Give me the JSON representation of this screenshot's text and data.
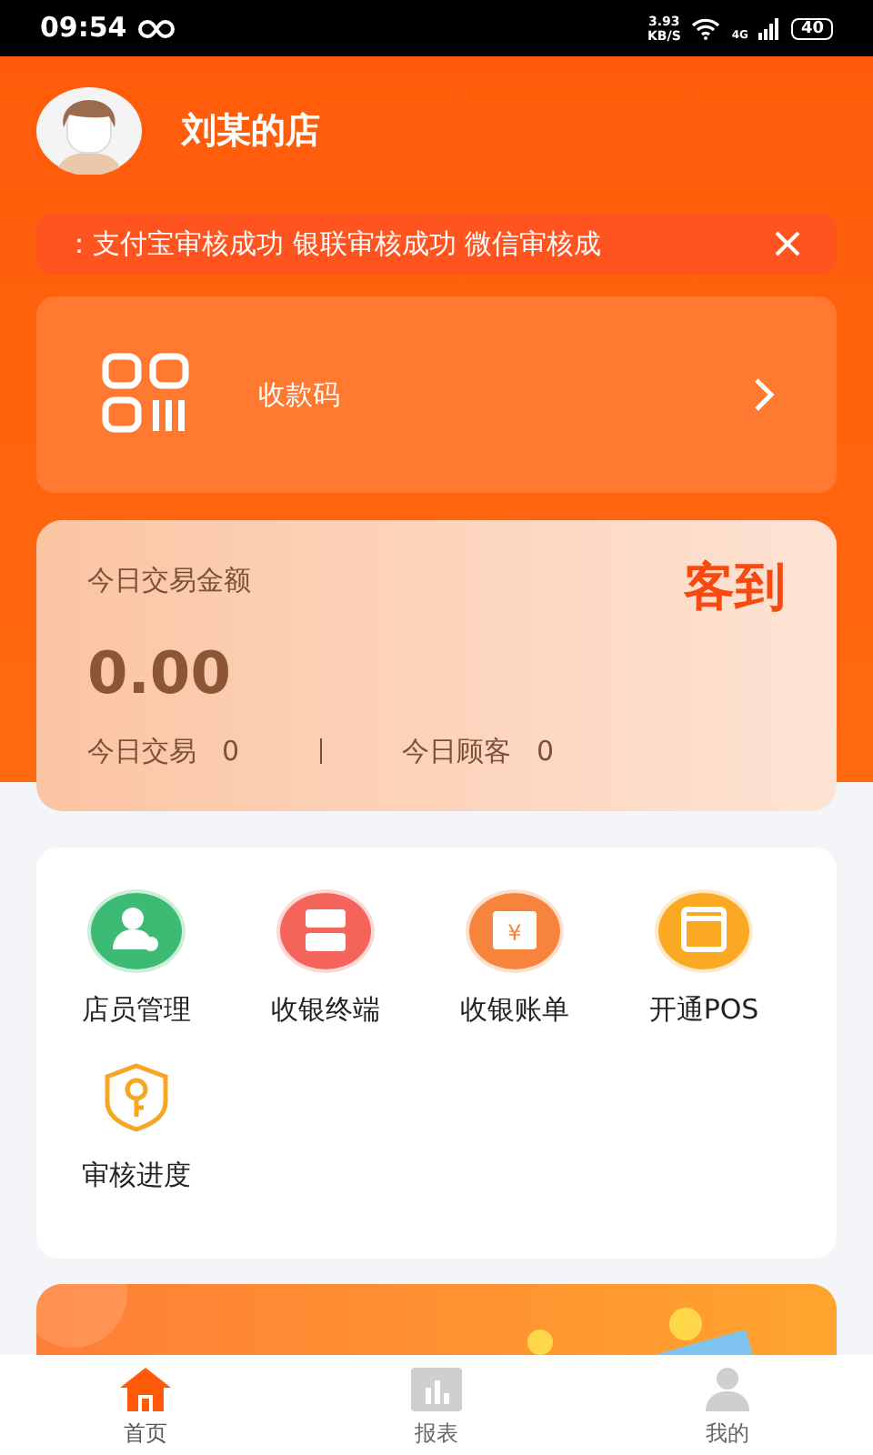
{
  "status_bar": {
    "time": "09:54",
    "speed_value": "3.93",
    "speed_unit": "KB/S",
    "network": "4G",
    "battery": "40"
  },
  "shop": {
    "name": "刘某的店"
  },
  "notice": {
    "text": "：支付宝审核成功 银联审核成功 微信审核成"
  },
  "payment_code": {
    "label": "收款码"
  },
  "stats": {
    "title": "今日交易金额",
    "amount": "0.00",
    "checkin": "客到",
    "items": [
      {
        "label": "今日交易",
        "value": "0"
      },
      {
        "label": "今日顾客",
        "value": "0"
      }
    ]
  },
  "menu": [
    {
      "kind": "staff",
      "label": "店员管理",
      "color": "#3dba74"
    },
    {
      "kind": "terminal",
      "label": "收银终端",
      "color": "#f4645a"
    },
    {
      "kind": "bill",
      "label": "收银账单",
      "color": "#f7843c",
      "symbol": "¥"
    },
    {
      "kind": "pos",
      "label": "开通POS",
      "color": "#fba823"
    },
    {
      "kind": "audit",
      "label": "审核进度",
      "color": "#f5a623"
    }
  ],
  "tabs": [
    {
      "kind": "home",
      "label": "首页",
      "selected": true
    },
    {
      "kind": "report",
      "label": "报表",
      "selected": false
    },
    {
      "kind": "me",
      "label": "我的",
      "selected": false
    }
  ]
}
